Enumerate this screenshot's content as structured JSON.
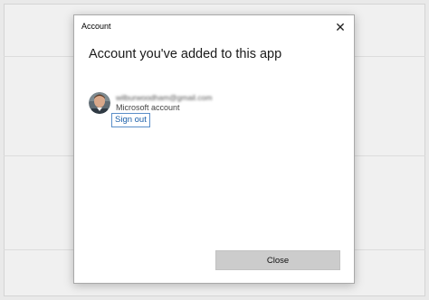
{
  "dialog": {
    "title": "Account",
    "heading": "Account you've added to this app",
    "close_glyph": "✕",
    "account": {
      "email": "wilburwoodham@gmail.com",
      "type": "Microsoft account",
      "sign_out_label": "Sign out"
    },
    "close_button_label": "Close"
  },
  "icons": {
    "close": "close-icon",
    "avatar": "user-avatar"
  },
  "colors": {
    "link": "#1b5fa8",
    "focus_border": "#5a8ec9",
    "button_bg": "#cccccc"
  }
}
